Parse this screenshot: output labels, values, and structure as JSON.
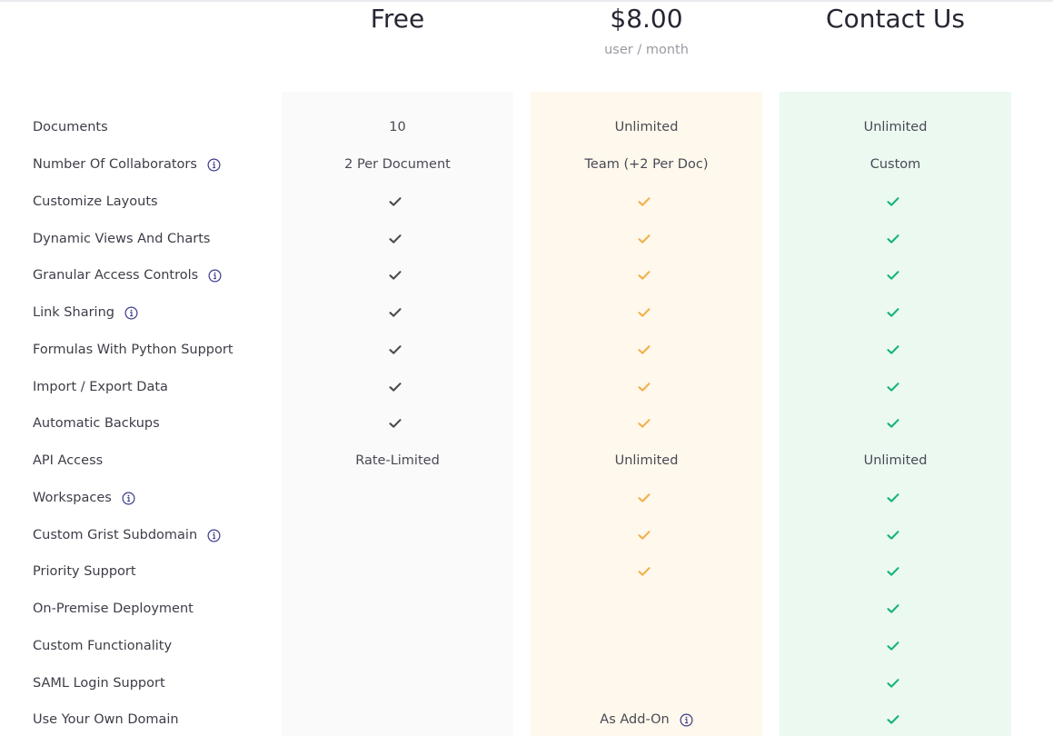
{
  "plans": [
    {
      "name": "Free",
      "subtitle": "",
      "color": "#4a4a4f",
      "bg": "#fafafa"
    },
    {
      "name": "$8.00",
      "subtitle": "user / month",
      "color": "#f1b04c",
      "bg": "#fff8ec"
    },
    {
      "name": "Contact Us",
      "subtitle": "",
      "color": "#16b378",
      "bg": "#ebf9f1"
    }
  ],
  "features": [
    {
      "label": "Documents",
      "info": false,
      "values": [
        "10",
        "Unlimited",
        "Unlimited"
      ]
    },
    {
      "label": "Number Of Collaborators",
      "info": true,
      "values": [
        "2 Per Document",
        "Team (+2 Per Doc)",
        "Custom"
      ]
    },
    {
      "label": "Customize Layouts",
      "info": false,
      "values": [
        "check",
        "check",
        "check"
      ]
    },
    {
      "label": "Dynamic Views And Charts",
      "info": false,
      "values": [
        "check",
        "check",
        "check"
      ]
    },
    {
      "label": "Granular Access Controls",
      "info": true,
      "values": [
        "check",
        "check",
        "check"
      ]
    },
    {
      "label": "Link Sharing",
      "info": true,
      "values": [
        "check",
        "check",
        "check"
      ]
    },
    {
      "label": "Formulas With Python Support",
      "info": false,
      "values": [
        "check",
        "check",
        "check"
      ]
    },
    {
      "label": "Import / Export Data",
      "info": false,
      "values": [
        "check",
        "check",
        "check"
      ]
    },
    {
      "label": "Automatic Backups",
      "info": false,
      "values": [
        "check",
        "check",
        "check"
      ]
    },
    {
      "label": "API Access",
      "info": false,
      "values": [
        "Rate-Limited",
        "Unlimited",
        "Unlimited"
      ]
    },
    {
      "label": "Workspaces",
      "info": true,
      "values": [
        "",
        "check",
        "check"
      ]
    },
    {
      "label": "Custom Grist Subdomain",
      "info": true,
      "values": [
        "",
        "check",
        "check"
      ]
    },
    {
      "label": "Priority Support",
      "info": false,
      "values": [
        "",
        "check",
        "check"
      ]
    },
    {
      "label": "On-Premise Deployment",
      "info": false,
      "values": [
        "",
        "",
        "check"
      ]
    },
    {
      "label": "Custom Functionality",
      "info": false,
      "values": [
        "",
        "",
        "check"
      ]
    },
    {
      "label": "SAML Login Support",
      "info": false,
      "values": [
        "",
        "",
        "check"
      ]
    },
    {
      "label": "Use Your Own Domain",
      "info": false,
      "values": [
        "",
        "As Add-On",
        "check"
      ],
      "value_info": [
        false,
        true,
        false
      ]
    }
  ],
  "icons": {
    "check": "check-icon",
    "info": "info-circle-icon"
  },
  "info_color": "#3b3b8f"
}
